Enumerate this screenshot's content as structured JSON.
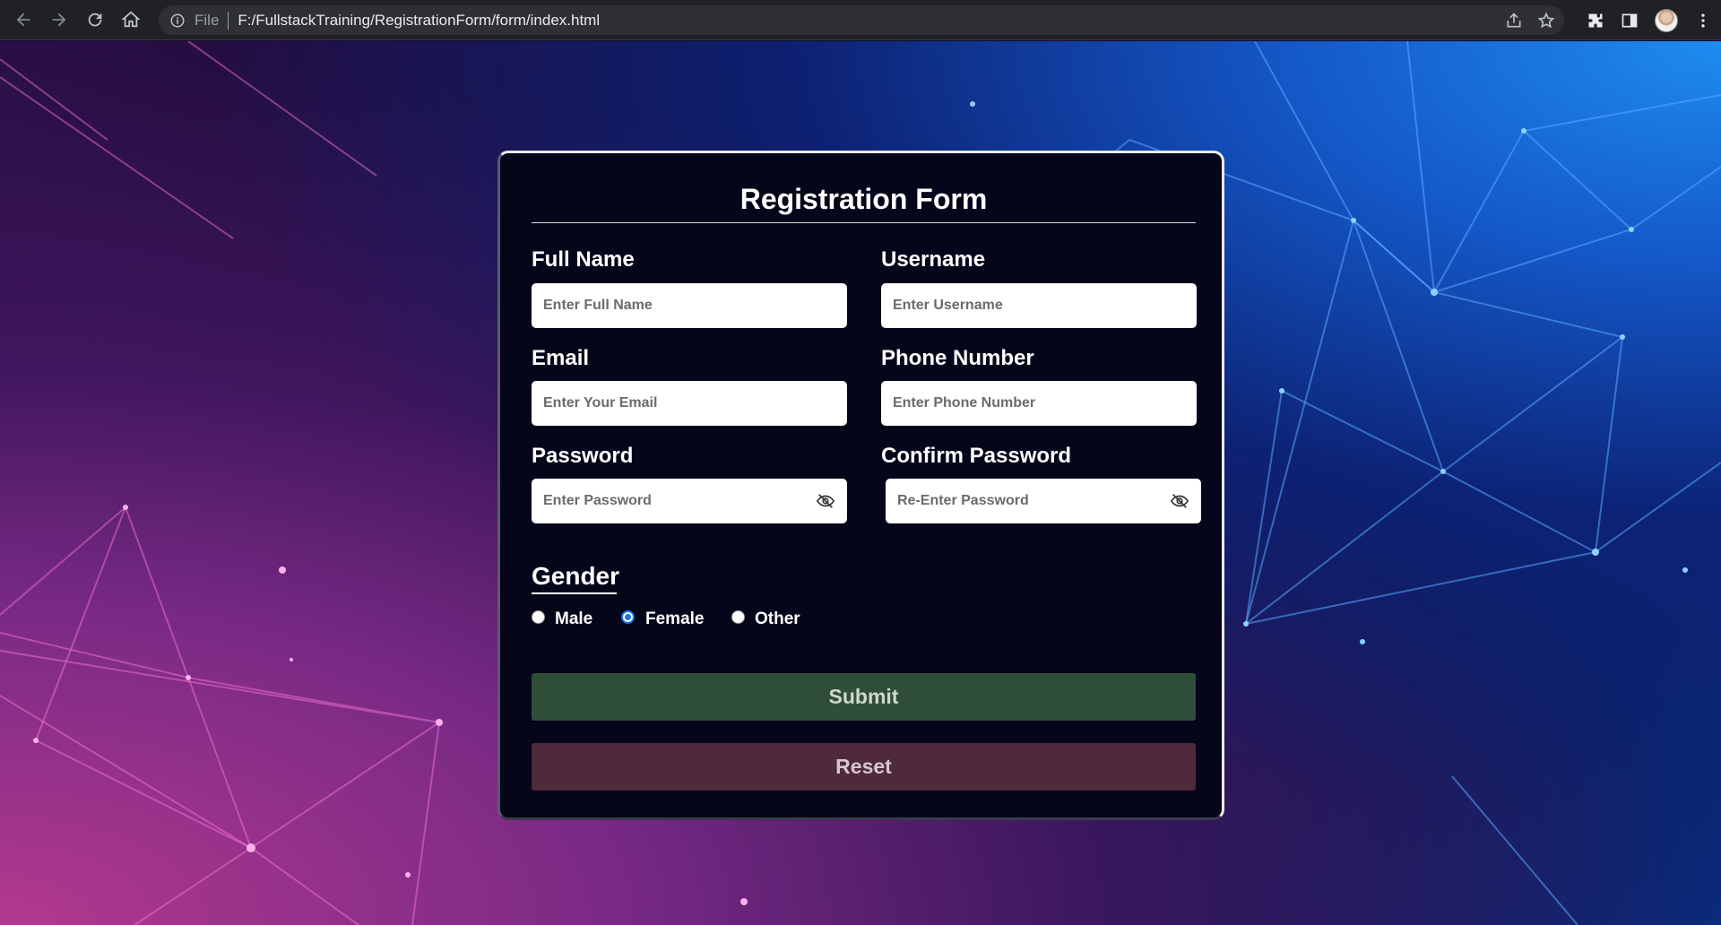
{
  "browser": {
    "scheme_label": "File",
    "url": "F:/FullstackTraining/RegistrationForm/form/index.html"
  },
  "form": {
    "title": "Registration Form",
    "fields": {
      "full_name": {
        "label": "Full Name",
        "placeholder": "Enter Full Name"
      },
      "username": {
        "label": "Username",
        "placeholder": "Enter Username"
      },
      "email": {
        "label": "Email",
        "placeholder": "Enter Your Email"
      },
      "phone": {
        "label": "Phone Number",
        "placeholder": "Enter Phone Number"
      },
      "password": {
        "label": "Password",
        "placeholder": "Enter Password"
      },
      "confirm_password": {
        "label": "Confirm Password",
        "placeholder": "Re-Enter Password"
      }
    },
    "gender": {
      "title": "Gender",
      "options": [
        {
          "label": "Male",
          "checked": false
        },
        {
          "label": "Female",
          "checked": true
        },
        {
          "label": "Other",
          "checked": false
        }
      ]
    },
    "submit_label": "Submit",
    "reset_label": "Reset"
  },
  "colors": {
    "submit_bg": "#2f4e39",
    "reset_bg": "#4e2a3b",
    "card_bg": "#05061a",
    "radio_accent": "#1a73e8"
  }
}
